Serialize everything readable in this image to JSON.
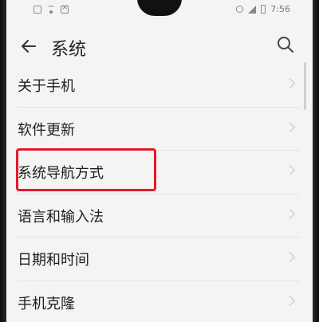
{
  "status_bar": {
    "time": "7:56"
  },
  "header": {
    "title": "系统"
  },
  "list": {
    "items": [
      {
        "label": "关于手机"
      },
      {
        "label": "软件更新"
      },
      {
        "label": "系统导航方式"
      },
      {
        "label": "语言和输入法"
      },
      {
        "label": "日期和时间"
      },
      {
        "label": "手机克隆"
      }
    ]
  },
  "colors": {
    "background": "#f4f4f4",
    "highlight": "#e6182b",
    "text": "#1e1e1e"
  },
  "icons": {
    "back": "arrow-left-icon",
    "search": "search-icon",
    "chevron": "chevron-right-icon"
  }
}
